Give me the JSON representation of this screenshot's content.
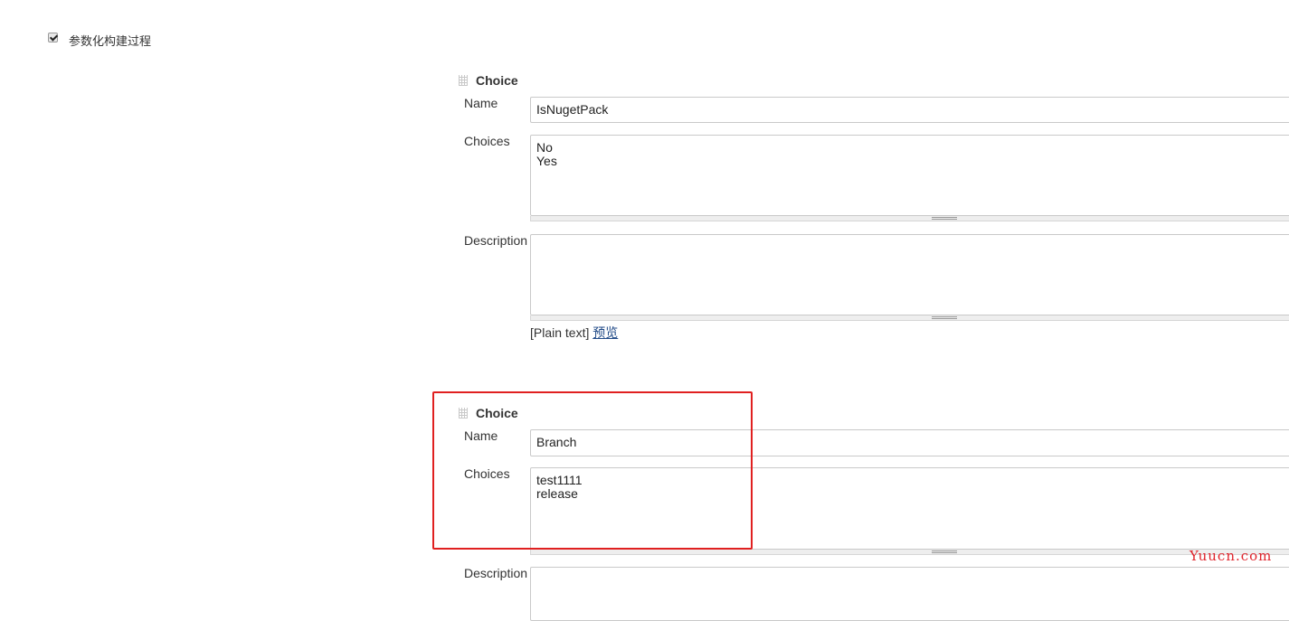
{
  "build_params_checkbox": {
    "label": "参数化构建过程",
    "checked": true
  },
  "parameters": [
    {
      "type_label": "Choice",
      "name_label": "Name",
      "name_value": "IsNugetPack",
      "choices_label": "Choices",
      "choices_lines": [
        "No",
        "Yes"
      ],
      "description_label": "Description",
      "description_value": "",
      "format_hint": "[Plain text]",
      "preview_link": "预览"
    },
    {
      "type_label": "Choice",
      "name_label": "Name",
      "name_value": "Branch",
      "choices_label": "Choices",
      "choices_lines": [
        "test1111",
        "release"
      ],
      "description_label": "Description",
      "description_value": ""
    }
  ],
  "watermark": "Yuucn.com",
  "colors": {
    "highlight": "#e02020",
    "link": "#204a87",
    "watermark": "#e0242c"
  }
}
